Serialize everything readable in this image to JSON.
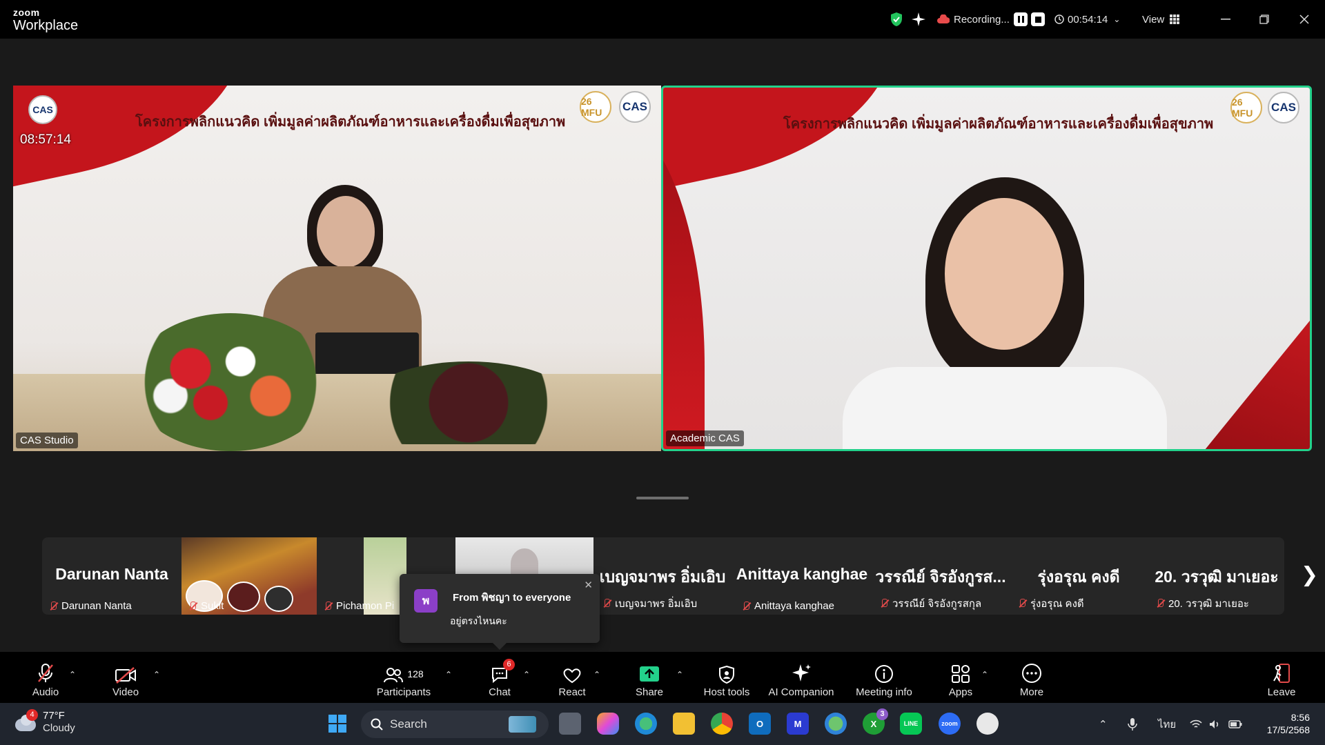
{
  "app": {
    "brand_top": "zoom",
    "brand_bottom": "Workplace"
  },
  "titlebar": {
    "recording_label": "Recording...",
    "timer": "00:54:14",
    "view_label": "View"
  },
  "main_tiles": [
    {
      "name": "CAS Studio",
      "headline": "โครงการพลิกแนวคิด เพิ่มมูลค่าผลิตภัณฑ์อาหารและเครื่องดื่มเพื่อสุขภาพ",
      "clock": "08:57:14",
      "logo_left": "CAS",
      "logo_mfu": "26 MFU",
      "logo_cas": "CAS"
    },
    {
      "name": "Academic CAS",
      "headline": "โครงการพลิกแนวคิด เพิ่มมูลค่าผลิตภัณฑ์อาหารและเครื่องดื่มเพื่อสุขภาพ",
      "logo_mfu": "26 MFU",
      "logo_cas": "CAS"
    }
  ],
  "gallery": [
    {
      "title": "Darunan Nanta",
      "label": "Darunan Nanta"
    },
    {
      "title": "",
      "label": "Sukit"
    },
    {
      "title": "",
      "label": "Pichamon Pi"
    },
    {
      "title": "",
      "label": ""
    },
    {
      "title": "เบญจมาพร อิ่มเอิบ",
      "label": "เบญจมาพร อิ่มเอิบ"
    },
    {
      "title": "Anittaya kanghae",
      "label": "Anittaya kanghae"
    },
    {
      "title": "วรรณีย์ จิรอังกูรส...",
      "label": "วรรณีย์ จิรอังกูรสกุล"
    },
    {
      "title": "รุ่งอรุณ คงดี",
      "label": "รุ่งอรุณ คงดี"
    },
    {
      "title": "20. วรวุฒิ มาเยอะ",
      "label": "20. วรวุฒิ มาเยอะ"
    }
  ],
  "chat_popup": {
    "avatar": "พ",
    "from": "From พิชญา to everyone",
    "message": "อยู่ตรงไหนคะ"
  },
  "controls": {
    "audio": "Audio",
    "video": "Video",
    "participants": "Participants",
    "participants_count": "128",
    "chat": "Chat",
    "chat_badge": "6",
    "react": "React",
    "share": "Share",
    "host_tools": "Host tools",
    "ai_companion": "AI Companion",
    "meeting_info": "Meeting info",
    "apps": "Apps",
    "more": "More",
    "leave": "Leave"
  },
  "taskbar": {
    "weather_temp": "77°F",
    "weather_cond": "Cloudy",
    "weather_badge": "4",
    "search_placeholder": "Search",
    "xbox_badge": "3",
    "language": "ไทย",
    "time": "8:56",
    "date": "17/5/2568"
  },
  "colors": {
    "active_speaker": "#23d18b",
    "share_green": "#23d18b",
    "alert_red": "#e02828"
  }
}
